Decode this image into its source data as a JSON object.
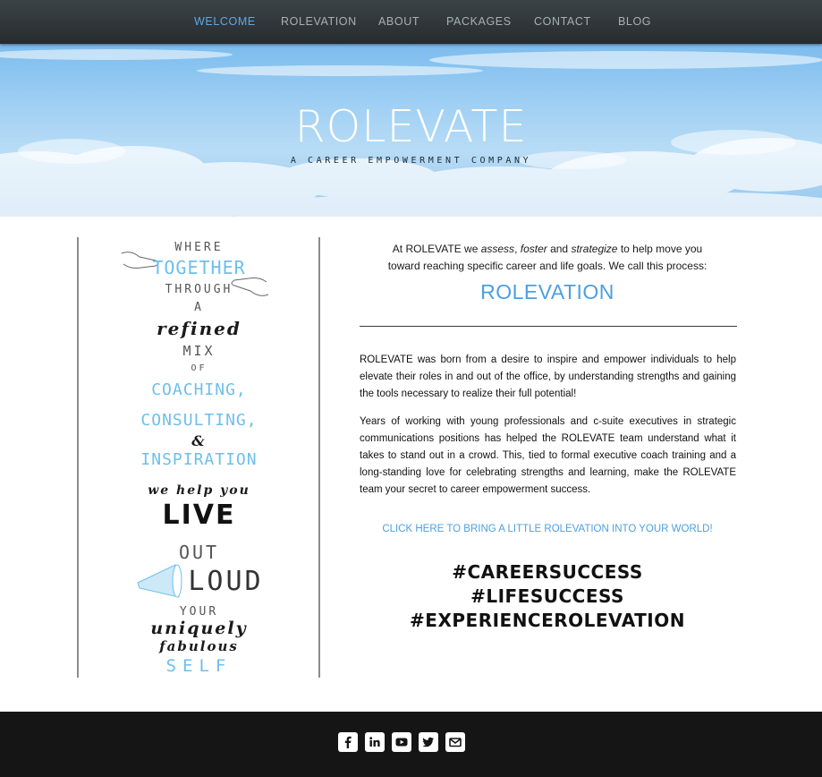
{
  "nav": {
    "items": [
      {
        "label": "WELCOME",
        "active": true
      },
      {
        "label": "ROLEVATION",
        "active": false
      },
      {
        "label": "ABOUT",
        "active": false
      },
      {
        "label": "PACKAGES",
        "active": false
      },
      {
        "label": "CONTACT",
        "active": false
      },
      {
        "label": "BLOG",
        "active": false
      }
    ]
  },
  "hero": {
    "title": "ROLEVATE",
    "tagline": "A CAREER EMPOWERMENT COMPANY"
  },
  "poster": {
    "lines": [
      "WHERE",
      "TOGETHER",
      "THROUGH",
      "A",
      "refined",
      "MIX",
      "OF",
      "COACHING,",
      "CONSULTING,",
      "&",
      "INSPIRATION",
      "we help you",
      "LIVE",
      "OUT",
      "LOUD",
      "YOUR",
      "uniquely",
      "fabulous",
      "SELF"
    ]
  },
  "intro": {
    "p1_a": "At ROLEVATE we ",
    "assess": "assess",
    "sep1": ", ",
    "foster": "foster",
    "and": " and ",
    "strategize": "strategize",
    "p1_b": " to help move you",
    "line2": "toward reaching specific career and life goals. We call this process:",
    "heading": "ROLEVATION"
  },
  "body": {
    "p1": "ROLEVATE was born from a desire to inspire and empower individuals to help elevate their roles in and out of the office, by understanding strengths and gaining the tools necessary to realize their full potential!",
    "p2": "Years of working with young professionals and c-suite executives in strategic communications positions has helped the ROLEVATE team understand what it takes to stand out in a crowd. This, tied to formal executive coach training and a long-standing love for celebrating strengths and learning, make the ROLEVATE team your secret to career empowerment success."
  },
  "cta": {
    "label": "CLICK HERE TO BRING A LITTLE ROLEVATION INTO YOUR WORLD!"
  },
  "hashtags": [
    "#CAREERSUCCESS",
    "#LIFESUCCESS",
    "#EXPERIENCEROLEVATION"
  ],
  "footer": {
    "social_icons": [
      "facebook-icon",
      "linkedin-icon",
      "youtube-icon",
      "twitter-icon",
      "email-icon"
    ]
  },
  "colors": {
    "accent": "#4c9fe0",
    "nav_bg": "#2f3538",
    "footer_bg": "#151515",
    "poster_blue": "#6dbfec"
  }
}
